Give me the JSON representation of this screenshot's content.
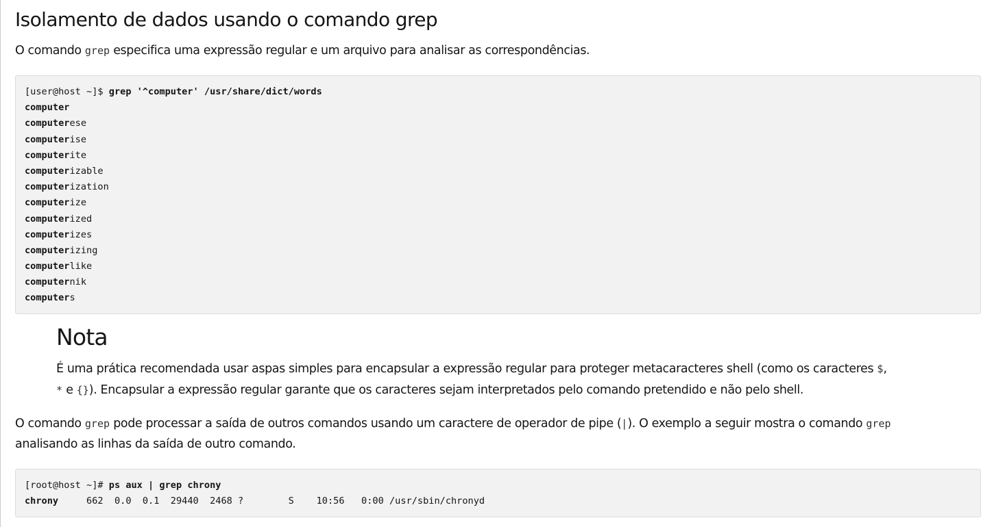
{
  "section": {
    "title": "Isolamento de dados usando o comando grep",
    "intro": {
      "before": "O comando ",
      "code": "grep",
      "after": " especifica uma expressão regular e um arquivo para analisar as correspondências."
    }
  },
  "code_block_1": {
    "prompt": "[user@host ~]$ ",
    "command": "grep '^computer' /usr/share/dict/words",
    "output": [
      {
        "match": "computer",
        "rest": ""
      },
      {
        "match": "computer",
        "rest": "ese"
      },
      {
        "match": "computer",
        "rest": "ise"
      },
      {
        "match": "computer",
        "rest": "ite"
      },
      {
        "match": "computer",
        "rest": "izable"
      },
      {
        "match": "computer",
        "rest": "ization"
      },
      {
        "match": "computer",
        "rest": "ize"
      },
      {
        "match": "computer",
        "rest": "ized"
      },
      {
        "match": "computer",
        "rest": "izes"
      },
      {
        "match": "computer",
        "rest": "izing"
      },
      {
        "match": "computer",
        "rest": "like"
      },
      {
        "match": "computer",
        "rest": "nik"
      },
      {
        "match": "computer",
        "rest": "s"
      }
    ]
  },
  "note": {
    "title": "Nota",
    "p1": "É uma prática recomendada usar aspas simples para encapsular a expressão regular para proteger metacaracteres shell (como os caracteres ",
    "c1": "$",
    "p2": ",",
    "c2": "*",
    "p3": " e ",
    "c3": "{}",
    "p4": "). Encapsular a expressão regular garante que os caracteres sejam interpretados pelo comando pretendido e não pelo shell."
  },
  "pipe_paragraph": {
    "before": "O comando ",
    "code1": "grep",
    "middle": " pode processar a saída de outros comandos usando um caractere de operador de pipe (",
    "code2": "|",
    "after": "). O exemplo a seguir mostra o comando ",
    "code3": "grep",
    "line2": "analisando as linhas da saída de outro comando."
  },
  "code_block_2": {
    "prompt": "[root@host ~]# ",
    "command": "ps aux | grep chrony",
    "output_match": "chrony",
    "output_rest": "     662  0.0  0.1  29440  2468 ?        S    10:56   0:00 /usr/sbin/chronyd"
  }
}
